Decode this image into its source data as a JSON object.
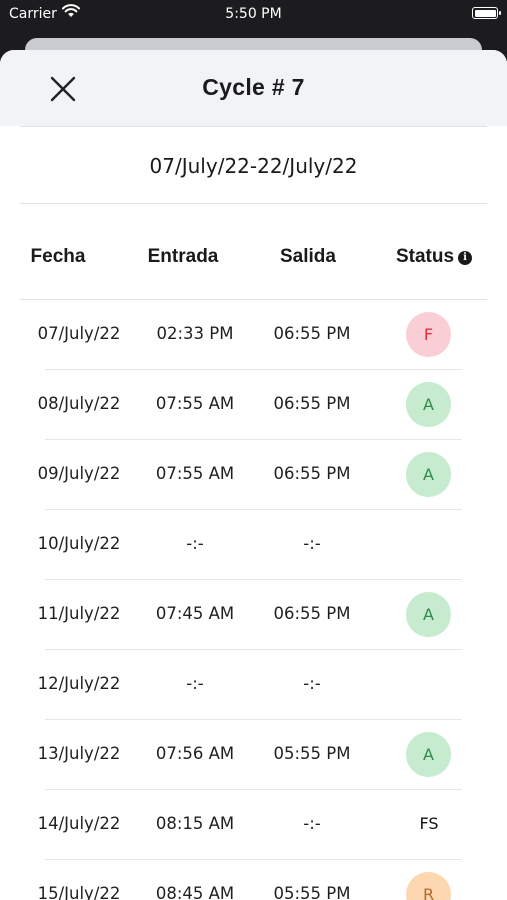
{
  "status_bar": {
    "carrier": "Carrier",
    "time": "5:50 PM"
  },
  "header": {
    "title": "Cycle # 7",
    "close_icon": "close-icon"
  },
  "cycle_range": "07/July/22-22/July/22",
  "table": {
    "columns": [
      "Fecha",
      "Entrada",
      "Salida",
      "Status"
    ],
    "rows": [
      {
        "fecha": "07/July/22",
        "entrada": "02:33 PM",
        "salida": "06:55 PM",
        "status": "F",
        "style": "red"
      },
      {
        "fecha": "08/July/22",
        "entrada": "07:55 AM",
        "salida": "06:55 PM",
        "status": "A",
        "style": "green"
      },
      {
        "fecha": "09/July/22",
        "entrada": "07:55 AM",
        "salida": "06:55 PM",
        "status": "A",
        "style": "green"
      },
      {
        "fecha": "10/July/22",
        "entrada": "-:-",
        "salida": "-:-",
        "status": "",
        "style": "none"
      },
      {
        "fecha": "11/July/22",
        "entrada": "07:45 AM",
        "salida": "06:55 PM",
        "status": "A",
        "style": "green"
      },
      {
        "fecha": "12/July/22",
        "entrada": "-:-",
        "salida": "-:-",
        "status": "",
        "style": "none"
      },
      {
        "fecha": "13/July/22",
        "entrada": "07:56 AM",
        "salida": "05:55 PM",
        "status": "A",
        "style": "green"
      },
      {
        "fecha": "14/July/22",
        "entrada": "08:15 AM",
        "salida": "-:-",
        "status": "FS",
        "style": "text"
      },
      {
        "fecha": "15/July/22",
        "entrada": "08:45 AM",
        "salida": "05:55 PM",
        "status": "R",
        "style": "orange"
      }
    ]
  },
  "colors": {
    "red_bg": "#f9cfd5",
    "red_text": "#e0303f",
    "green_bg": "#c6ebcf",
    "green_text": "#2f8a49",
    "orange_bg": "#fcd7b0",
    "orange_text": "#b8692a"
  }
}
